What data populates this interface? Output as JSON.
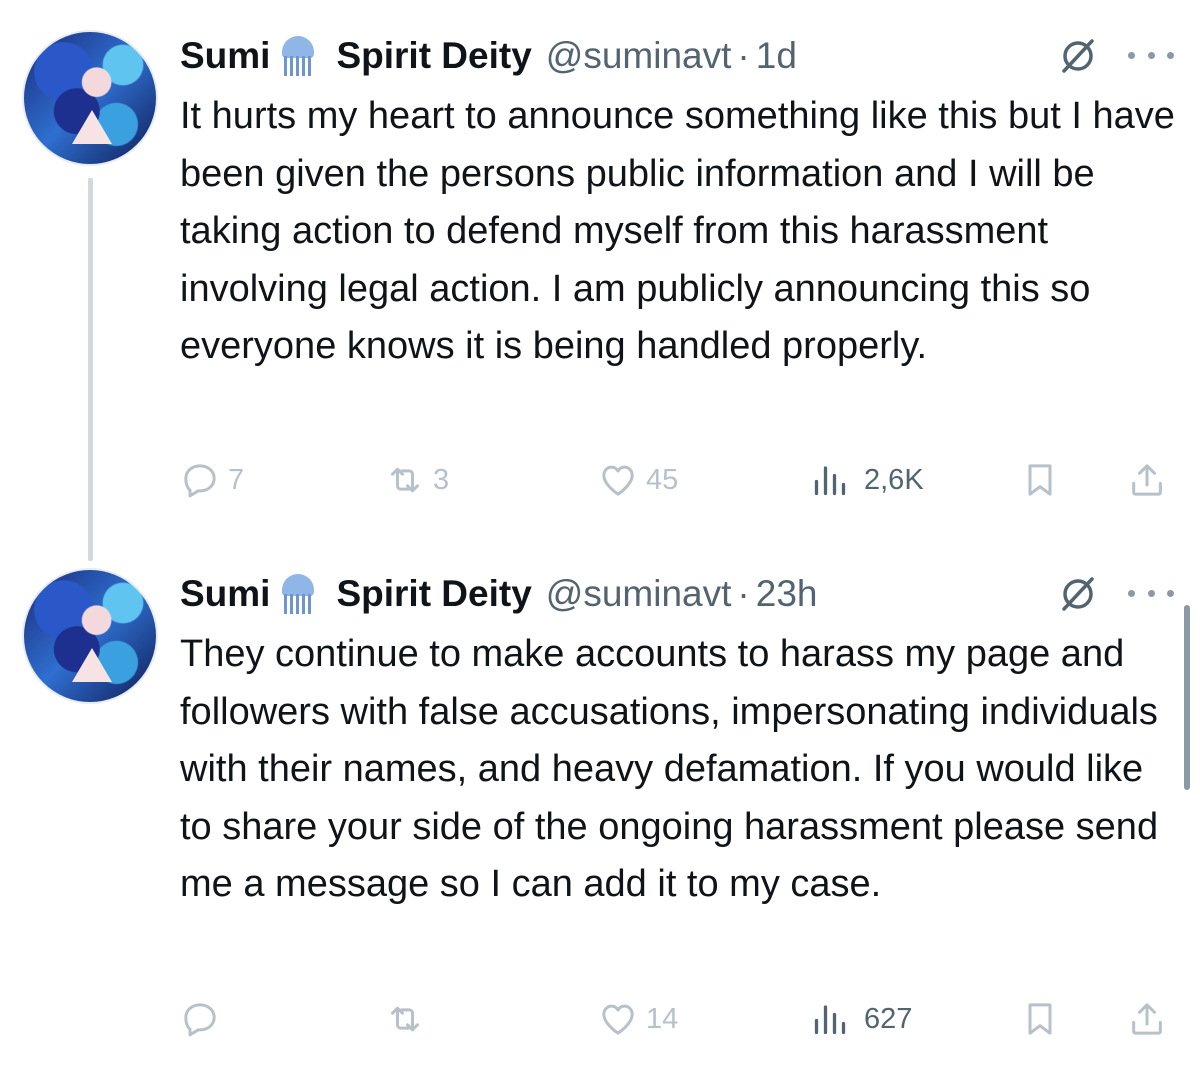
{
  "tweets": [
    {
      "display_name": "Sumi",
      "name_suffix": "Spirit Deity",
      "handle": "@suminavt",
      "separator": "·",
      "time": "1d",
      "text": "It hurts my heart to announce something like this but I have been given the persons public information and I will be taking action to defend myself from this harassment involving legal action. I am publicly announcing this so everyone knows it is being handled properly.",
      "replies": "7",
      "reposts": "3",
      "likes": "45",
      "views": "2,6K"
    },
    {
      "display_name": "Sumi",
      "name_suffix": "Spirit Deity",
      "handle": "@suminavt",
      "separator": "·",
      "time": "23h",
      "text": "They continue to make accounts to harass my page and followers with false accusations, impersonating individuals with their names, and heavy defamation. If you would like to share your side of the ongoing harassment please send me a message so I can add it to my case.",
      "replies": "",
      "reposts": "",
      "likes": "14",
      "views": "627"
    }
  ],
  "icons": {
    "name_emoji": "jellyfish-icon",
    "grok": "grok-icon",
    "more": "more-icon",
    "reply": "reply-icon",
    "repost": "repost-icon",
    "like": "heart-icon",
    "views": "views-icon",
    "bookmark": "bookmark-icon",
    "share": "share-icon"
  },
  "colors": {
    "text": "#0f1419",
    "secondary": "#536471",
    "faded_icon": "#b7c1ca",
    "thread_line": "#cfd9de"
  }
}
